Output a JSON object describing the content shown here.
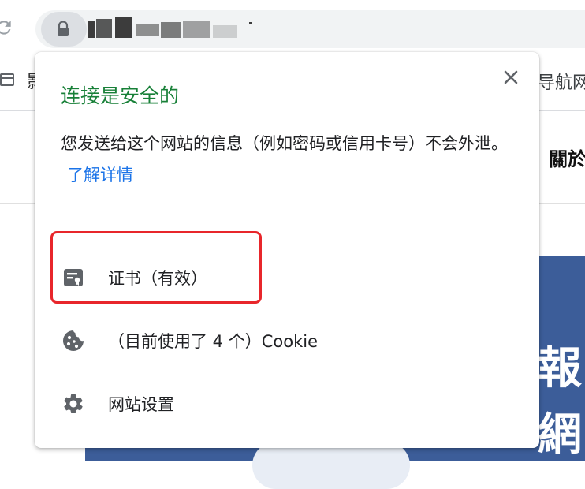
{
  "browser": {
    "bookmark_left_label": "影",
    "bookmark_right_label": "导航网",
    "page_right_text": "關於",
    "banner_chars": [
      "報",
      "網"
    ]
  },
  "popup": {
    "title": "连接是安全的",
    "description": "您发送给这个网站的信息（例如密码或信用卡号）不会外泄。",
    "learn_more": "了解详情",
    "certificate_label": "证书（有效）",
    "cookies_label": "（目前使用了 4 个）Cookie",
    "site_settings_label": "网站设置"
  },
  "icons": {
    "reload": "reload-icon",
    "lock": "lock-icon",
    "close": "close-icon",
    "certificate": "certificate-icon",
    "cookie": "cookie-icon",
    "settings": "gear-icon",
    "bookmark_folder": "folder-icon"
  },
  "colors": {
    "secure_green": "#188038",
    "link_blue": "#1a73e8",
    "highlight_red": "#e8262b",
    "banner_blue": "#3c5d99"
  }
}
